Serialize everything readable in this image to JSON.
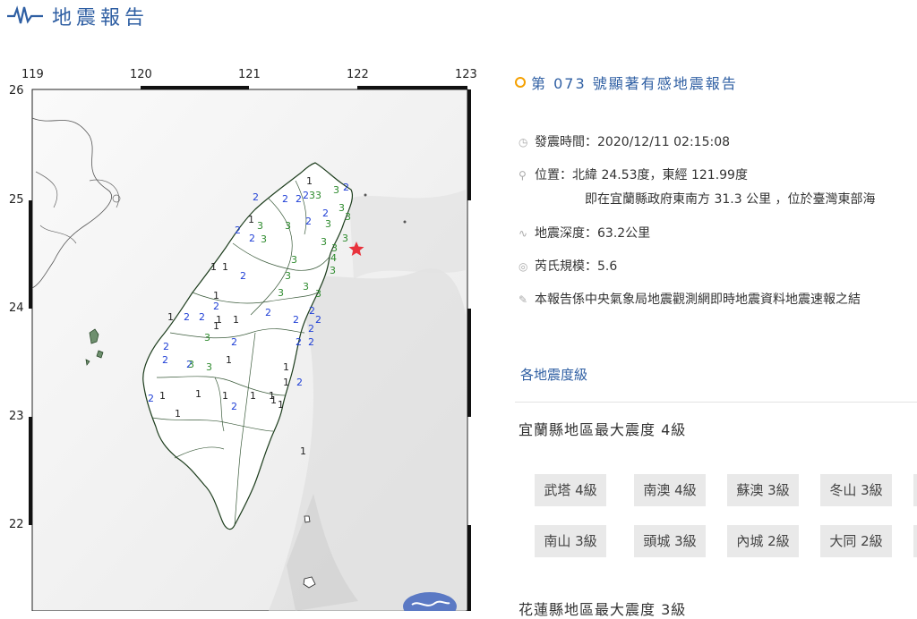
{
  "header": {
    "title": "地震報告",
    "icon": "waveform-icon"
  },
  "map": {
    "x_ticks": [
      "119",
      "120",
      "121",
      "122",
      "123"
    ],
    "y_ticks": [
      "26",
      "25",
      "24",
      "23",
      "22"
    ],
    "epicenter_icon": "red-star-icon",
    "intensity_colors": {
      "1": "#222222",
      "2": "#1f3fd6",
      "3": "#2e8b2e",
      "4": "#2e8b2e"
    },
    "intensity_labels": [
      {
        "v": "1"
      },
      {
        "v": "2"
      },
      {
        "v": "3"
      },
      {
        "v": "3"
      },
      {
        "v": "3"
      },
      {
        "v": "2"
      },
      {
        "v": "2"
      },
      {
        "v": "2"
      },
      {
        "v": "3"
      },
      {
        "v": "3"
      },
      {
        "v": "2"
      },
      {
        "v": "3"
      },
      {
        "v": "1"
      },
      {
        "v": "2"
      },
      {
        "v": "3"
      },
      {
        "v": "2"
      },
      {
        "v": "3"
      },
      {
        "v": "2"
      },
      {
        "v": "2"
      },
      {
        "v": "3"
      },
      {
        "v": "3"
      },
      {
        "v": "3"
      },
      {
        "v": "3"
      },
      {
        "v": "3"
      },
      {
        "v": "4"
      },
      {
        "v": "3"
      },
      {
        "v": "1"
      },
      {
        "v": "1"
      },
      {
        "v": "2"
      },
      {
        "v": "3"
      },
      {
        "v": "3"
      },
      {
        "v": "1"
      },
      {
        "v": "2"
      },
      {
        "v": "3"
      },
      {
        "v": "3"
      },
      {
        "v": "1"
      },
      {
        "v": "1"
      },
      {
        "v": "2"
      },
      {
        "v": "2"
      },
      {
        "v": "2"
      },
      {
        "v": "1"
      },
      {
        "v": "2"
      },
      {
        "v": "2"
      },
      {
        "v": "1"
      },
      {
        "v": "2"
      },
      {
        "v": "2"
      },
      {
        "v": "2"
      },
      {
        "v": "2"
      },
      {
        "v": "2"
      },
      {
        "v": "3"
      },
      {
        "v": "2"
      },
      {
        "v": "3"
      },
      {
        "v": "2"
      },
      {
        "v": "2"
      },
      {
        "v": "1"
      },
      {
        "v": "2"
      },
      {
        "v": "3"
      },
      {
        "v": "1"
      },
      {
        "v": "1"
      },
      {
        "v": "2"
      },
      {
        "v": "1"
      },
      {
        "v": "1"
      },
      {
        "v": "1"
      },
      {
        "v": "1"
      },
      {
        "v": "1"
      },
      {
        "v": "2"
      },
      {
        "v": "1"
      },
      {
        "v": "1"
      },
      {
        "v": "1"
      },
      {
        "v": "1"
      }
    ]
  },
  "report": {
    "title": "第 073 號顯著有感地震報告",
    "time_label": "發震時間：",
    "time_value": "2020/12/11 02:15:08",
    "location_label": "位置：",
    "location_value": "北緯 24.53度，東經 121.99度",
    "location_detail": "即在宜蘭縣政府東南方 31.3 公里 ，位於臺灣東部海",
    "depth_label": "地震深度：",
    "depth_value": "63.2公里",
    "magnitude_label": "芮氏規模：",
    "magnitude_value": "5.6",
    "note": "本報告係中央氣象局地震觀測網即時地震資料地震速報之結",
    "icons": {
      "time": "clock-icon",
      "location": "map-pin-icon",
      "depth": "seismic-icon",
      "magnitude": "signal-icon",
      "note": "pencil-icon"
    }
  },
  "intensity_section": {
    "link": "各地震度級",
    "regions": [
      {
        "heading": "宜蘭縣地區最大震度 4級",
        "stations": [
          "武塔 4級",
          "南澳 4級",
          "蘇澳 3級",
          "冬山 3級",
          "南山 3級",
          "頭城 3級",
          "內城 2級",
          "大同 2級"
        ]
      },
      {
        "heading": "花蓮縣地區最大震度 3級",
        "stations": []
      }
    ]
  }
}
